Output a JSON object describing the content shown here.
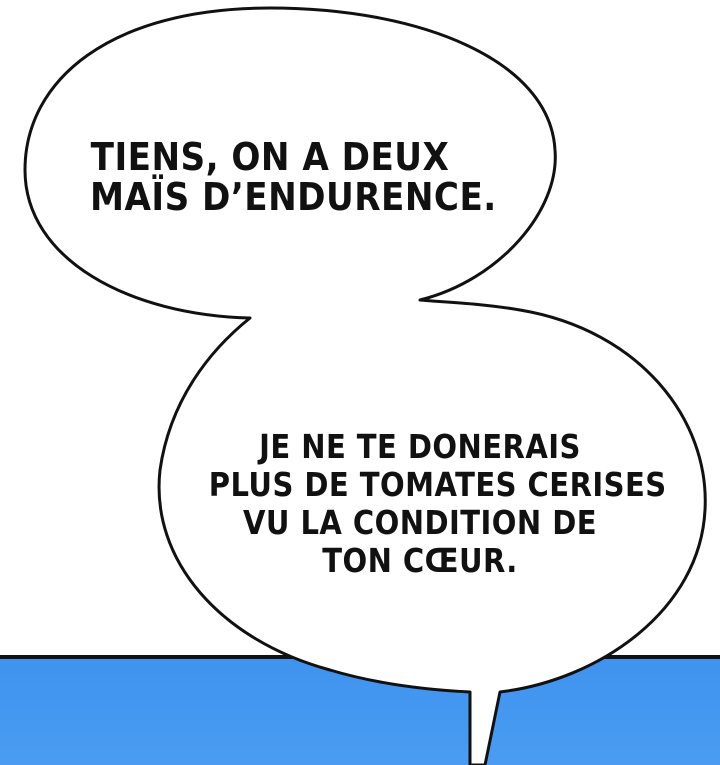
{
  "colors": {
    "sky": "#4598f0",
    "bubble_fill": "#ffffff",
    "outline": "#111111"
  },
  "bubbles": [
    {
      "lines": [
        "TIENS, ON A DEUX",
        "MAÏS D’ENDURENCE."
      ]
    },
    {
      "lines": [
        "JE NE TE DONERAIS",
        "PLUS DE TOMATES CERISES",
        "VU LA CONDITION DE",
        "TON CŒUR."
      ]
    }
  ]
}
